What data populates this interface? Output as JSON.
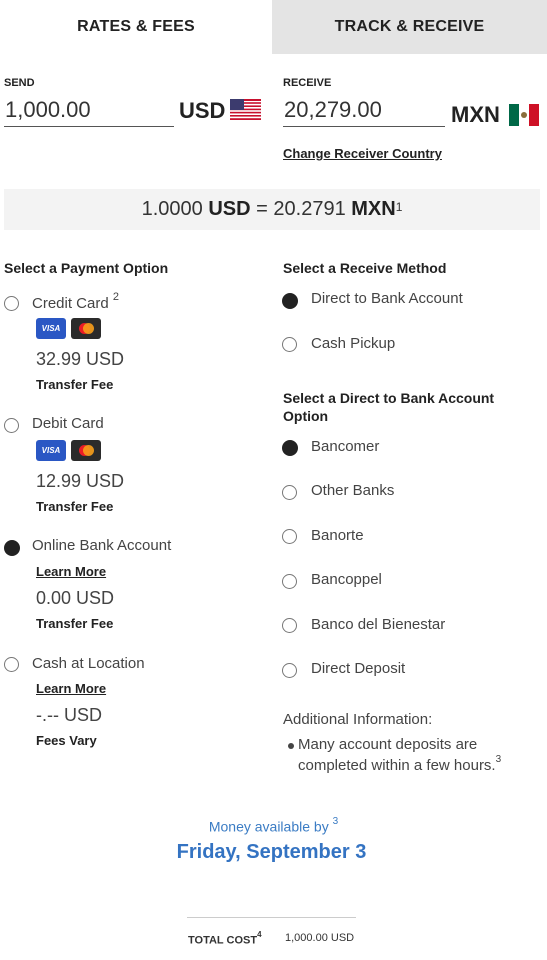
{
  "tabs": [
    {
      "label": "RATES & FEES",
      "active": true
    },
    {
      "label": "TRACK & RECEIVE",
      "active": false
    }
  ],
  "send": {
    "label": "SEND",
    "value": "1,000.00",
    "currency": "USD",
    "flag_icon": "us-flag-icon"
  },
  "receive": {
    "label": "RECEIVE",
    "value": "20,279.00",
    "currency": "MXN",
    "flag_icon": "mx-flag-icon",
    "change_link": "Change Receiver Country"
  },
  "rate": {
    "from_amount": "1.0000",
    "from_currency": "USD",
    "equals": "=",
    "to_amount": "20.2791",
    "to_currency": "MXN",
    "footnote": "1"
  },
  "payment": {
    "title": "Select a Payment Option",
    "options": [
      {
        "label": "Credit Card",
        "footnote": "2",
        "selected": false,
        "cards": [
          "VISA",
          "mastercard"
        ],
        "fee": "32.99 USD",
        "fee_label": "Transfer Fee"
      },
      {
        "label": "Debit Card",
        "footnote": "",
        "selected": false,
        "cards": [
          "VISA",
          "mastercard"
        ],
        "fee": "12.99 USD",
        "fee_label": "Transfer Fee"
      },
      {
        "label": "Online Bank Account",
        "footnote": "",
        "selected": true,
        "learn_more": "Learn More",
        "fee": "0.00 USD",
        "fee_label": "Transfer Fee"
      },
      {
        "label": "Cash at Location",
        "footnote": "",
        "selected": false,
        "learn_more": "Learn More",
        "fee": "-.-- USD",
        "fee_label": "Fees Vary"
      }
    ]
  },
  "receive_method": {
    "title": "Select a Receive Method",
    "options": [
      {
        "label": "Direct to Bank Account",
        "selected": true
      },
      {
        "label": "Cash Pickup",
        "selected": false
      }
    ]
  },
  "bank_option": {
    "title_line1": "Select a Direct to Bank Account",
    "title_line2": "Option",
    "options": [
      {
        "label": "Bancomer",
        "selected": true
      },
      {
        "label": "Other Banks",
        "selected": false
      },
      {
        "label": "Banorte",
        "selected": false
      },
      {
        "label": "Bancoppel",
        "selected": false
      },
      {
        "label": "Banco del Bienestar",
        "selected": false
      },
      {
        "label": "Direct Deposit",
        "selected": false
      }
    ]
  },
  "additional": {
    "title": "Additional Information:",
    "bullet": "Many account deposits are completed within a few hours.",
    "footnote": "3"
  },
  "availability": {
    "label": "Money available by",
    "footnote": "3",
    "date": "Friday, September 3"
  },
  "total": {
    "label": "TOTAL COST",
    "footnote": "4",
    "value": "1,000.00 USD"
  },
  "colors": {
    "accent_blue": "#3473c2",
    "tab_inactive_bg": "#e4e4e4",
    "rate_bar_bg": "#f3f3f3",
    "visa_blue": "#2a57c4"
  }
}
